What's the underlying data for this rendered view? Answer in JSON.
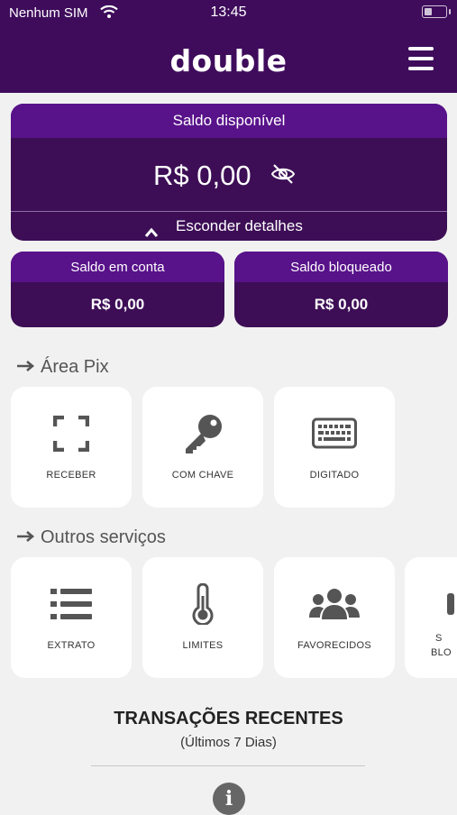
{
  "status_bar": {
    "carrier": "Nenhum SIM",
    "time": "13:45"
  },
  "header": {
    "logo": "double"
  },
  "balance": {
    "title": "Saldo disponível",
    "amount": "R$ 0,00",
    "hide_label": "Esconder detalhes"
  },
  "account_balances": [
    {
      "label": "Saldo em conta",
      "value": "R$ 0,00"
    },
    {
      "label": "Saldo bloqueado",
      "value": "R$ 0,00"
    }
  ],
  "pix": {
    "title": "Área Pix",
    "items": [
      {
        "label": "RECEBER",
        "icon": "scan-frame-icon"
      },
      {
        "label": "COM CHAVE",
        "icon": "key-icon"
      },
      {
        "label": "DIGITADO",
        "icon": "keyboard-icon"
      }
    ]
  },
  "services": {
    "title": "Outros serviços",
    "items": [
      {
        "label": "EXTRATO",
        "icon": "list-icon"
      },
      {
        "label": "LIMITES",
        "icon": "thermometer-icon"
      },
      {
        "label": "FAVORECIDOS",
        "icon": "users-icon"
      },
      {
        "label_line1": "S",
        "label_line2": "BLO",
        "icon": "unknown-icon"
      }
    ]
  },
  "recent": {
    "title": "TRANSAÇÕES RECENTES",
    "subtitle": "(Últimos 7 Dias)"
  },
  "colors": {
    "header": "#3f0c5c",
    "card_dark": "#3d0e56",
    "card_head": "#58128a",
    "icon": "#555555"
  }
}
